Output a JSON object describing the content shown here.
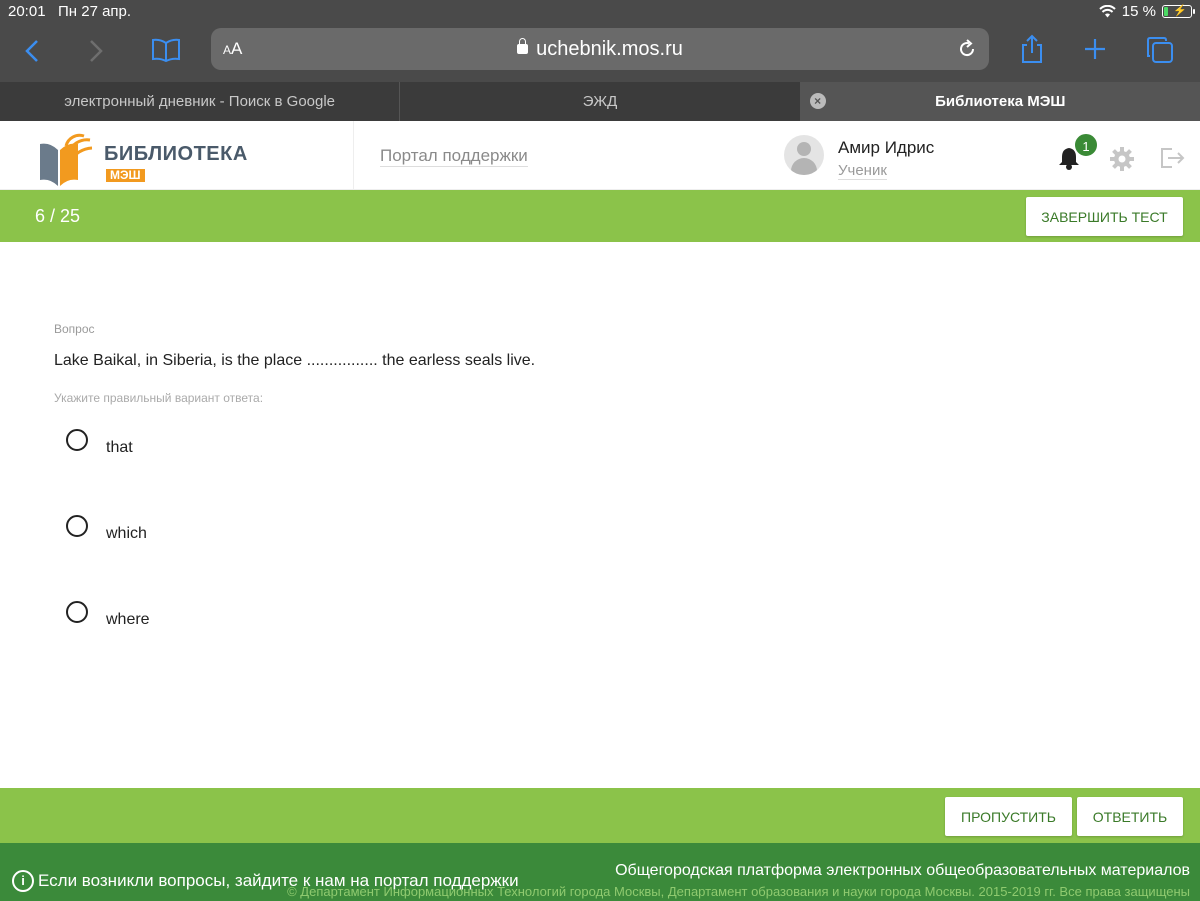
{
  "status_bar": {
    "time": "20:01",
    "date": "Пн 27 апр.",
    "battery": "15 %",
    "battery_level": 0.15
  },
  "browser": {
    "text_size_label": "AA",
    "url": "uchebnik.mos.ru",
    "tabs": [
      {
        "label": "электронный дневник - Поиск в Google",
        "active": false
      },
      {
        "label": "ЭЖД",
        "active": false
      },
      {
        "label": "Библиотека МЭШ",
        "active": true
      }
    ]
  },
  "header": {
    "logo_title": "БИБЛИОТЕКА",
    "logo_subtitle": "МЭШ",
    "support_link": "Портал поддержки",
    "user_name": "Амир Идрис",
    "user_role": "Ученик",
    "notification_count": "1"
  },
  "progress": {
    "text": "6 / 25",
    "finish_label": "ЗАВЕРШИТЬ ТЕСТ"
  },
  "question": {
    "label": "Вопрос",
    "text": "Lake Baikal, in Siberia, is the place ................ the earless seals live.",
    "hint": "Укажите правильный вариант ответа:",
    "options": [
      "that",
      "which",
      "where"
    ]
  },
  "actions": {
    "skip_label": "ПРОПУСТИТЬ",
    "answer_label": "ОТВЕТИТЬ"
  },
  "footer": {
    "help_text": "Если возникли вопросы, зайдите к нам на портал поддержки",
    "platform_text": "Общегородская платформа электронных общеобразовательных материалов",
    "copyright": "© Департамент Информационных Технологий города Москвы, Департамент образования и науки города Москвы. 2015-2019 гг. Все права защищены"
  },
  "colors": {
    "green_bar": "#8bc34a",
    "footer_green": "#3b8a3a",
    "button_text": "#3a7a28",
    "browser_chrome": "#4a4a4a",
    "safari_blue": "#3b8ef0",
    "logo_orange": "#f29a1f"
  }
}
